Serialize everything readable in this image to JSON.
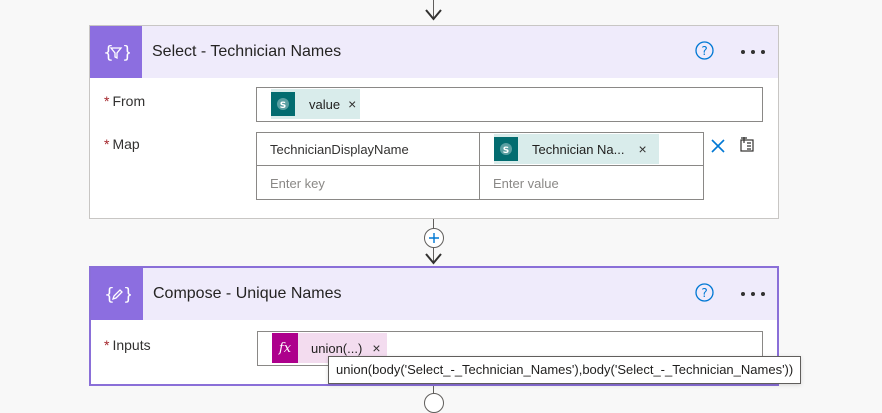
{
  "colors": {
    "action_accent": "#8c6ee0",
    "header_bg": "#efebfb",
    "sharepoint_token": "#036c70",
    "expression_token": "#ad008c",
    "selected_border": "#8a6fd8"
  },
  "select_card": {
    "title": "Select - Technician Names",
    "icon": "data-operations-select-icon",
    "help_icon": "help-circle-icon",
    "more_icon": "more-ellipsis-icon",
    "from": {
      "label": "From",
      "required_marker": "*",
      "token": {
        "label": "value",
        "icon": "sharepoint-icon",
        "remove": "×"
      }
    },
    "map": {
      "label": "Map",
      "required_marker": "*",
      "rows": [
        {
          "key": "TechnicianDisplayName",
          "value_token": {
            "label": "Technician Na...",
            "icon": "sharepoint-icon",
            "remove": "×"
          }
        }
      ],
      "key_placeholder": "Enter key",
      "value_placeholder": "Enter value",
      "switch_mode_icon": "close-x-icon",
      "text_mode_icon": "switch-to-text-mode-icon"
    }
  },
  "insert_step": {
    "icon": "plus-icon"
  },
  "compose_card": {
    "title": "Compose - Unique Names",
    "icon": "data-operations-compose-icon",
    "help_icon": "help-circle-icon",
    "more_icon": "more-ellipsis-icon",
    "inputs": {
      "label": "Inputs",
      "required_marker": "*",
      "token": {
        "label": "union(...)",
        "icon_text": "fx",
        "remove": "×"
      }
    },
    "tooltip": "union(body('Select_-_Technician_Names'),body('Select_-_Technician_Names'))"
  }
}
